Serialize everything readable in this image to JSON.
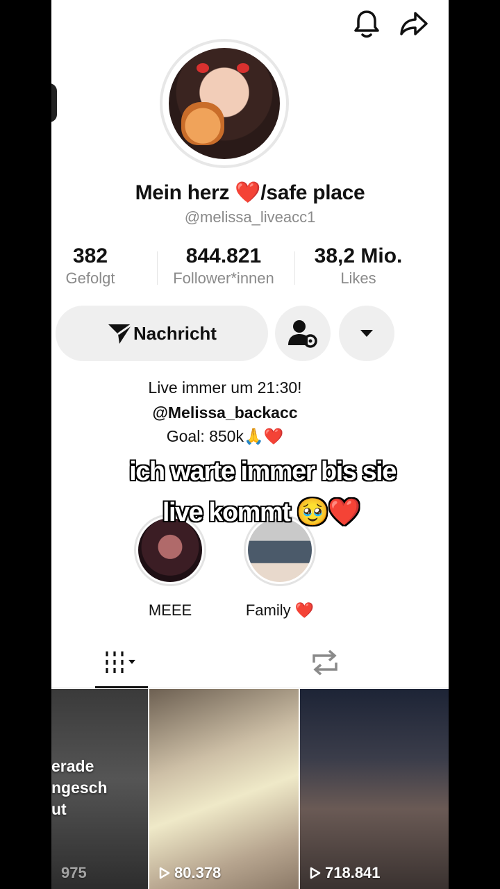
{
  "profile": {
    "name": "Mein herz ❤️/safe place",
    "handle": "@melissa_liveacc1"
  },
  "stats": [
    {
      "value": "382",
      "label": "Gefolgt"
    },
    {
      "value": "844.821",
      "label": "Follower*innen"
    },
    {
      "value": "38,2 Mio.",
      "label": "Likes"
    }
  ],
  "actions": {
    "message_label": "Nachricht"
  },
  "bio": {
    "line1": "Live immer um 21:30!",
    "line2": "@Melissa_backacc",
    "line3": "Goal: 850k🙏❤️"
  },
  "overlay": {
    "line1": "ich warte immer bis sie",
    "line2": "live kommt 🥹❤️"
  },
  "highlights": [
    {
      "label": "MEEE"
    },
    {
      "label": "Family ❤️"
    }
  ],
  "videos": [
    {
      "caption": "erade\nngesch\nut",
      "views": "975"
    },
    {
      "views": "80.378"
    },
    {
      "views": "718.841"
    }
  ],
  "icons": [
    "bell-icon",
    "share-icon",
    "send-icon",
    "add-friend-settings-icon",
    "dropdown-arrow-icon",
    "grid-icon",
    "repost-icon",
    "play-icon"
  ],
  "colors": {
    "accent_heart": "#ff3b5c",
    "text_secondary": "#8a8a8a",
    "button_bg": "#efefef"
  }
}
